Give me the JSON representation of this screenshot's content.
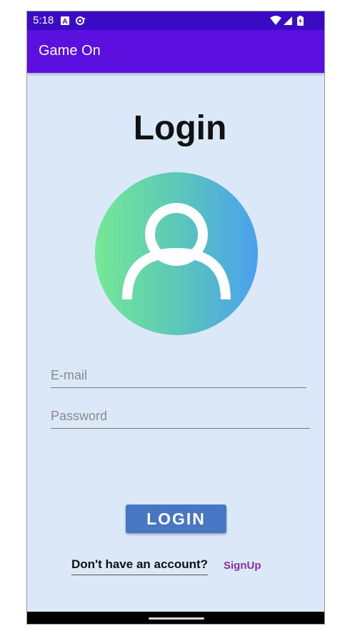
{
  "status_bar": {
    "time": "5:18",
    "icons": [
      "a-notification-icon",
      "sync-notification-icon",
      "wifi-icon",
      "cellular-signal-icon",
      "battery-icon"
    ]
  },
  "app_bar": {
    "title": "Game On"
  },
  "login": {
    "heading": "Login",
    "avatar_icon": "user-icon",
    "email_placeholder": "E-mail",
    "password_placeholder": "Password",
    "button_label": "LOGIN",
    "no_account_text": "Don't have an account?",
    "signup_link": "SignUp"
  },
  "colors": {
    "status_bar": "#3b0ac4",
    "app_bar": "#5b10e0",
    "background": "#dbe8f8",
    "button": "#4777c2",
    "signup_link": "#8a2ea8"
  }
}
